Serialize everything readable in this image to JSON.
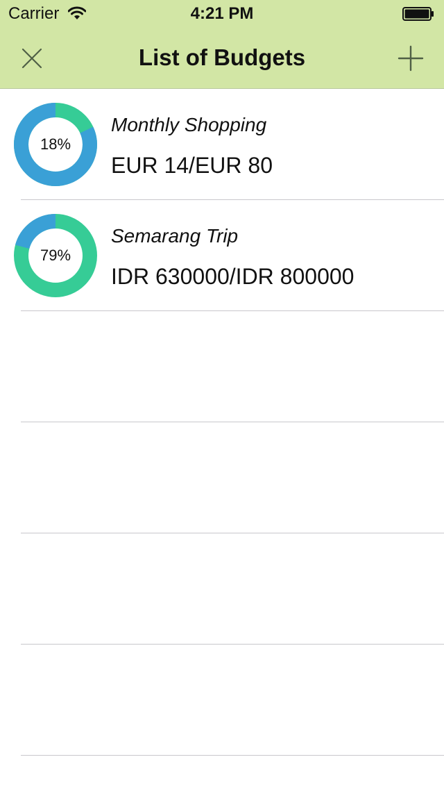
{
  "status_bar": {
    "carrier": "Carrier",
    "time": "4:21 PM",
    "icons": [
      "wifi-icon",
      "battery-icon"
    ]
  },
  "nav": {
    "title": "List of Budgets",
    "left_icon": "close-icon",
    "right_icon": "plus-icon"
  },
  "colors": {
    "header_bg": "#d2e6a5",
    "icon_color": "#4f5f45",
    "spent_color": "#3aa0d6",
    "remaining_color": "#36cc96",
    "separator": "#c8c7cc"
  },
  "budgets": [
    {
      "name": "Monthly Shopping",
      "amount": "EUR 14/EUR 80",
      "percent_label": "18%",
      "spent_fraction": 0.18
    },
    {
      "name": "Semarang Trip",
      "amount": "IDR 630000/IDR 800000",
      "percent_label": "79%",
      "spent_fraction": 0.79
    }
  ],
  "empty_row_count": 4
}
